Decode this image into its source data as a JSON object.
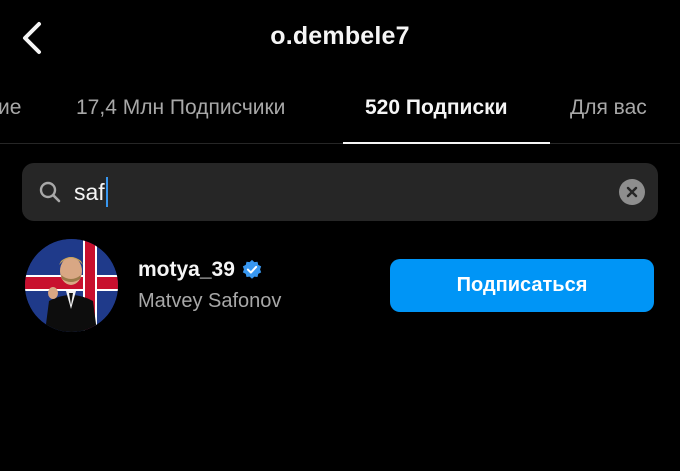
{
  "header": {
    "title": "o.dembele7"
  },
  "tabs": [
    {
      "label": "ие"
    },
    {
      "label": "17,4 Млн Подписчики"
    },
    {
      "label": "520 Подписки"
    },
    {
      "label": "Для вас"
    }
  ],
  "search": {
    "value": "saf"
  },
  "results": [
    {
      "username": "motya_39",
      "full_name": "Matvey Safonov",
      "verified": true,
      "button_label": "Подписаться"
    }
  ],
  "colors": {
    "background": "#000000",
    "accent": "#0095f6",
    "verified_badge": "#3897f0",
    "search_bg": "#262626",
    "secondary_text": "#a8a8a8"
  }
}
